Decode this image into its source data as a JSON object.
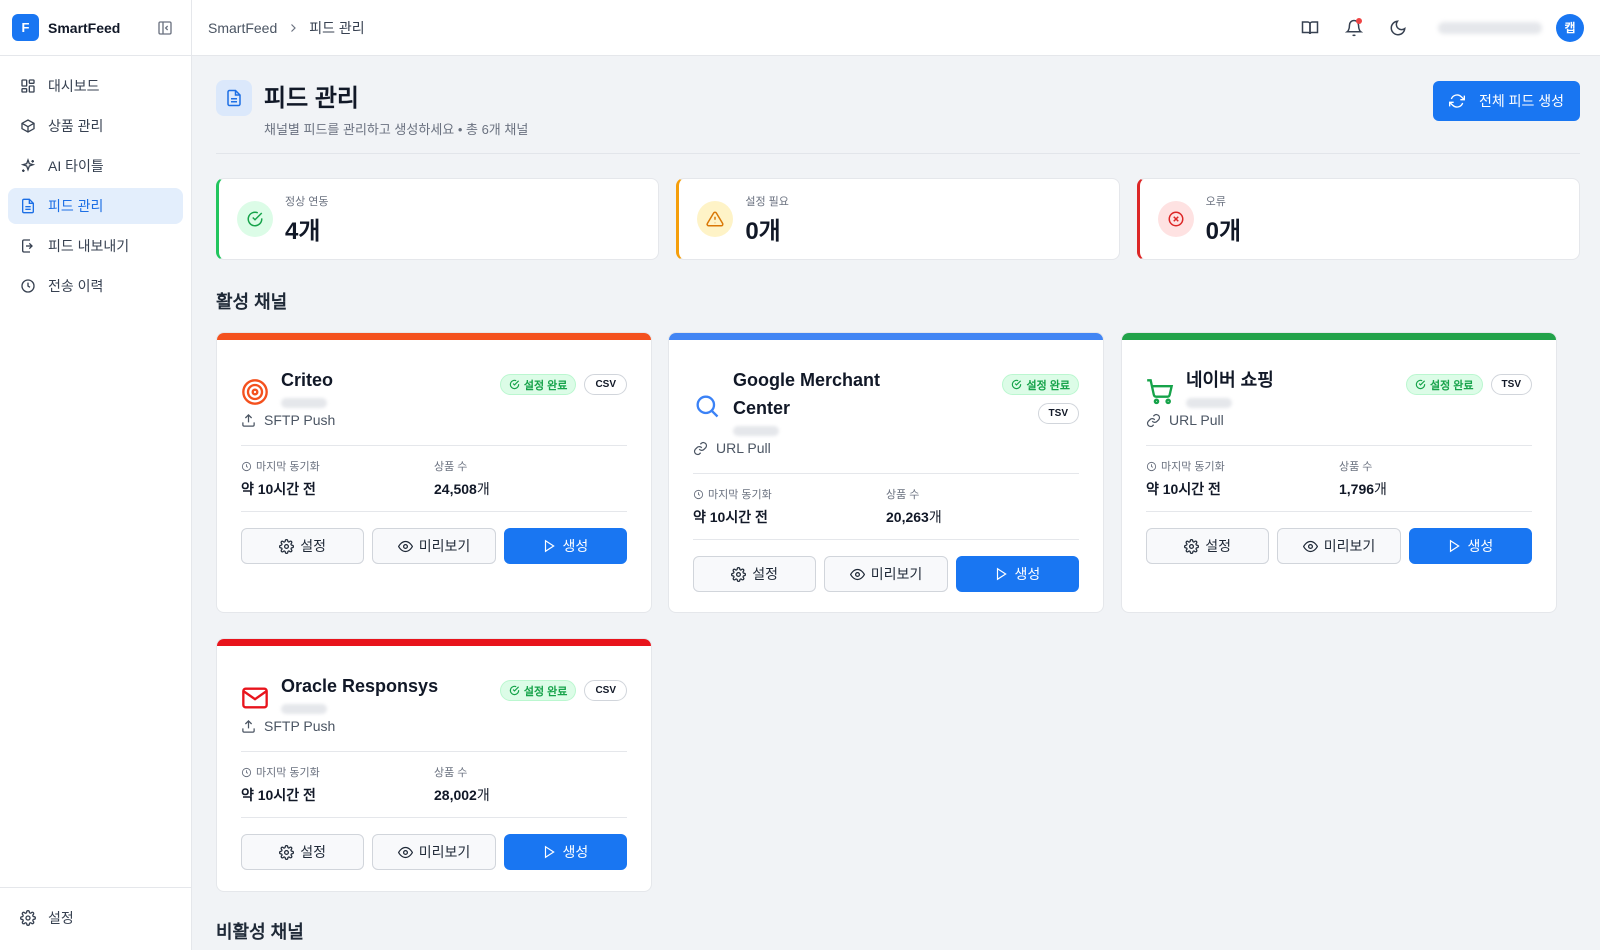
{
  "app": {
    "logo_letter": "F",
    "name": "SmartFeed"
  },
  "sidebar": {
    "items": [
      {
        "label": "대시보드",
        "icon": "dashboard-icon"
      },
      {
        "label": "상품 관리",
        "icon": "package-icon"
      },
      {
        "label": "AI 타이틀",
        "icon": "sparkles-icon"
      },
      {
        "label": "피드 관리",
        "icon": "file-text-icon",
        "active": true
      },
      {
        "label": "피드 내보내기",
        "icon": "export-icon"
      },
      {
        "label": "전송 이력",
        "icon": "clock-icon"
      }
    ],
    "settings_label": "설정"
  },
  "header": {
    "breadcrumb": [
      "SmartFeed",
      "피드 관리"
    ],
    "avatar_initial": "캡"
  },
  "page": {
    "title": "피드 관리",
    "subtitle": "채널별 피드를 관리하고 생성하세요 • 총 6개 채널",
    "generate_all_label": "전체 피드 생성"
  },
  "stats": [
    {
      "label": "정상 연동",
      "value": "4개",
      "color": "#22c55e",
      "bg": "#dcfce7"
    },
    {
      "label": "설정 필요",
      "value": "0개",
      "color": "#f59e0b",
      "bg": "#fef3c7"
    },
    {
      "label": "오류",
      "value": "0개",
      "color": "#dc2626",
      "bg": "#fee2e2"
    }
  ],
  "sections": {
    "active": "활성 채널",
    "inactive": "비활성 채널"
  },
  "channels": [
    {
      "name": "Criteo",
      "accent": "#f4511e",
      "icon": "target-icon",
      "status": "설정 완료",
      "format": "CSV",
      "method": "SFTP Push",
      "method_icon": "upload-icon",
      "last_sync_label": "마지막 동기화",
      "last_sync": "약 10시간 전",
      "count_label": "상품 수",
      "count": "24,508",
      "count_unit": "개",
      "settings": "설정",
      "preview": "미리보기",
      "generate": "생성"
    },
    {
      "name": "Google Merchant Center",
      "accent": "#4285f4",
      "icon": "search-icon",
      "status": "설정 완료",
      "format": "TSV",
      "method": "URL Pull",
      "method_icon": "link-icon",
      "last_sync_label": "마지막 동기화",
      "last_sync": "약 10시간 전",
      "count_label": "상품 수",
      "count": "20,263",
      "count_unit": "개",
      "settings": "설정",
      "preview": "미리보기",
      "generate": "생성"
    },
    {
      "name": "네이버 쇼핑",
      "accent": "#22a24a",
      "icon": "cart-icon",
      "status": "설정 완료",
      "format": "TSV",
      "method": "URL Pull",
      "method_icon": "link-icon",
      "last_sync_label": "마지막 동기화",
      "last_sync": "약 10시간 전",
      "count_label": "상품 수",
      "count": "1,796",
      "count_unit": "개",
      "settings": "설정",
      "preview": "미리보기",
      "generate": "생성"
    },
    {
      "name": "Oracle Responsys",
      "accent": "#e8141c",
      "icon": "mail-icon",
      "status": "설정 완료",
      "format": "CSV",
      "method": "SFTP Push",
      "method_icon": "upload-icon",
      "last_sync_label": "마지막 동기화",
      "last_sync": "약 10시간 전",
      "count_label": "상품 수",
      "count": "28,002",
      "count_unit": "개",
      "settings": "설정",
      "preview": "미리보기",
      "generate": "생성"
    }
  ]
}
